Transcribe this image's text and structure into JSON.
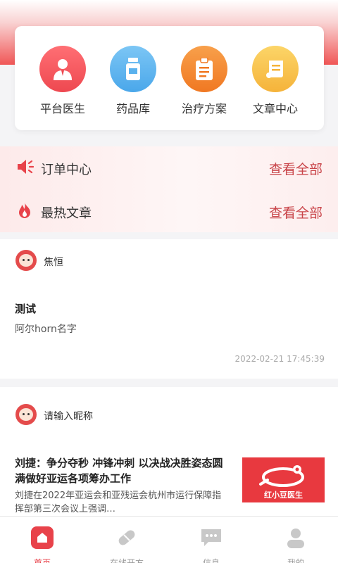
{
  "quick_menu": [
    {
      "label": "平台医生",
      "icon": "doctor-icon",
      "color": "#f2565c"
    },
    {
      "label": "药品库",
      "icon": "medicine-bottle-icon",
      "color": "#5ab2ee"
    },
    {
      "label": "治疗方案",
      "icon": "clipboard-icon",
      "color": "#f48a2c"
    },
    {
      "label": "文章中心",
      "icon": "scroll-icon",
      "color": "#f8c54b"
    }
  ],
  "sections": {
    "orders": {
      "title": "订单中心",
      "more": "查看全部"
    },
    "hot_articles": {
      "title": "最热文章",
      "more": "查看全部"
    }
  },
  "posts": [
    {
      "author": "焦恒",
      "title": "测试",
      "summary": "阿尔horn名字",
      "time": "2022-02-21 17:45:39"
    },
    {
      "author": "请输入昵称",
      "title": "刘捷：争分夺秒 冲锋冲刺 以决战决胜姿态圆满做好亚运各项筹办工作",
      "summary": "刘捷在2022年亚运会和亚残运会杭州市运行保障指挥部第三次会议上强调…",
      "thumb_text": "红小豆医生"
    }
  ],
  "tabbar": [
    {
      "label": "首页",
      "icon": "home-icon",
      "active": true
    },
    {
      "label": "在线开方",
      "icon": "pill-icon",
      "active": false
    },
    {
      "label": "信息",
      "icon": "message-icon",
      "active": false
    },
    {
      "label": "我的",
      "icon": "user-icon",
      "active": false
    }
  ],
  "colors": {
    "accent": "#e8424a",
    "link": "#c9454a"
  }
}
